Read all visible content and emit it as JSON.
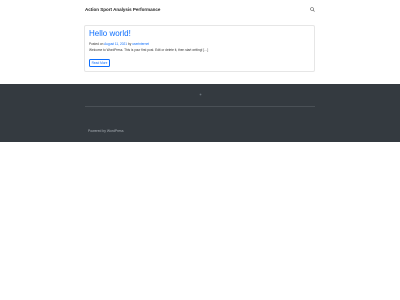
{
  "header": {
    "site_title": "Action Sport Analysis Performance",
    "search_icon": "search-icon"
  },
  "post": {
    "title": "Hello world!",
    "meta_prefix": "Posted on ",
    "date": "August 11, 2021",
    "meta_by": " by ",
    "author": "userinternet",
    "excerpt": "Welcome to WordPress. This is your first post. Edit or delete it, then start writing! […]",
    "read_more": "Read More"
  },
  "footer": {
    "powered_by": "Powered by WordPress",
    "background": "#343a40"
  },
  "colors": {
    "accent": "#0d6efd"
  }
}
